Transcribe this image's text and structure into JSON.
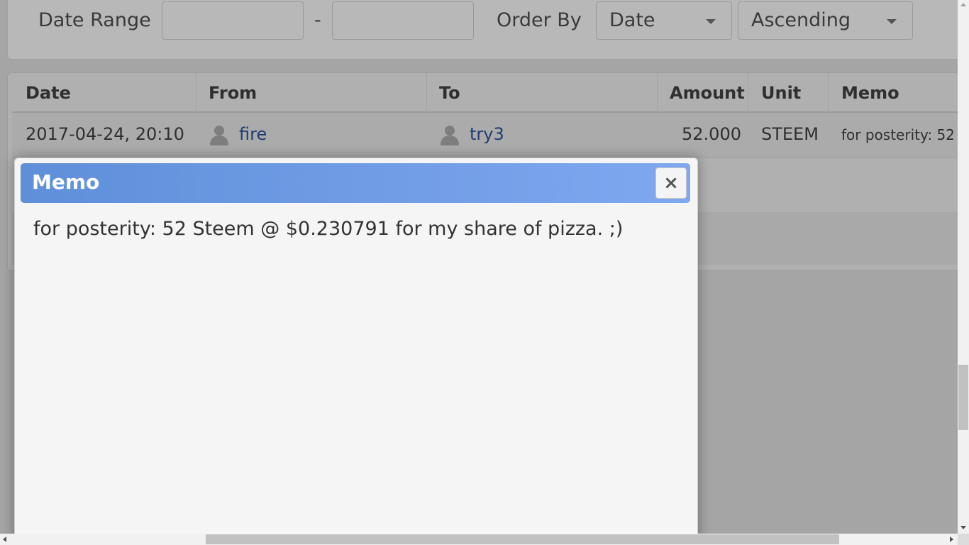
{
  "filters": {
    "date_range_label": "Date Range",
    "date_from": "",
    "separator": "-",
    "date_to": "",
    "order_by_label": "Order By",
    "order_by_value": "Date",
    "order_dir_value": "Ascending"
  },
  "table": {
    "columns": [
      "Date",
      "From",
      "To",
      "Amount",
      "Unit",
      "Memo"
    ],
    "rows": [
      {
        "date": "2017-04-24, 20:10",
        "from": "fire",
        "to": "try3",
        "amount": "52.000",
        "unit": "STEEM",
        "memo": "for posterity: 52 Steem @ $0.230791 for my share of pizza. ;)"
      }
    ]
  },
  "modal": {
    "title": "Memo",
    "close_label": "×",
    "body": "for posterity: 52 Steem @ $0.230791 for my share of pizza. ;)"
  },
  "icons": {
    "user": "user-icon",
    "close": "close-icon",
    "dropdown": "chevron-down-icon"
  },
  "colors": {
    "modal_header_start": "#5f8fd9",
    "modal_header_end": "#7fa8f0",
    "link": "#1f3d73"
  }
}
